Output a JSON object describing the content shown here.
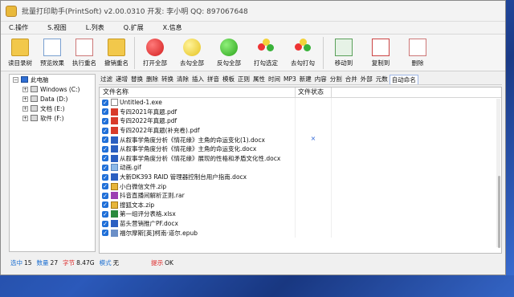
{
  "window": {
    "title": "批量打印助手(PrintSoft) v2.00.0310 开发: 李小明 QQ: 897067648"
  },
  "menu": [
    "C.操作",
    "S.视图",
    "L.列表",
    "Q.扩展",
    "X.信息"
  ],
  "toolbar": [
    {
      "label": "读目录树",
      "icon": "folder-icon"
    },
    {
      "label": "预览效果",
      "icon": "preview-icon"
    },
    {
      "label": "执行重名",
      "icon": "rename-icon"
    },
    {
      "label": "撤销重名",
      "icon": "undo-rename-icon"
    },
    {
      "label": "打开全部",
      "icon": "open-all-icon"
    },
    {
      "label": "去勾全部",
      "icon": "uncheck-all-icon"
    },
    {
      "label": "反勾全部",
      "icon": "invert-check-icon"
    },
    {
      "label": "打勾选定",
      "icon": "check-selected-icon"
    },
    {
      "label": "去勾打勾",
      "icon": "toggle-check-icon"
    },
    {
      "label": "移动到",
      "icon": "move-to-icon"
    },
    {
      "label": "复制到",
      "icon": "copy-to-icon"
    },
    {
      "label": "删除",
      "icon": "delete-icon"
    }
  ],
  "tree": [
    {
      "label": "此电脑",
      "level": 0
    },
    {
      "label": "Windows (C:)",
      "level": 1
    },
    {
      "label": "Data (D:)",
      "level": 1
    },
    {
      "label": "文档 (E:)",
      "level": 1
    },
    {
      "label": "软件 (F:)",
      "level": 1
    }
  ],
  "func_tabs": [
    "过滤",
    "递增",
    "替换",
    "删除",
    "转换",
    "清除",
    "插入",
    "拼音",
    "模板",
    "正则",
    "属性",
    "时间",
    "MP3",
    "新建",
    "内容",
    "分割",
    "合并",
    "外部",
    "元数",
    "自动命名"
  ],
  "table": {
    "col_name": "文件名称",
    "col_status": "文件状态",
    "rows": [
      {
        "name": "Untitled-1.exe",
        "type": "txt",
        "status": ""
      },
      {
        "name": "专四2021年真题.pdf",
        "type": "pdf",
        "status": ""
      },
      {
        "name": "专四2022年真题.pdf",
        "type": "pdf",
        "status": ""
      },
      {
        "name": "专四2022年真题(补充卷).pdf",
        "type": "pdf",
        "status": ""
      },
      {
        "name": "从叙事学角度分析《情花缘》主角的命运变化(1).docx",
        "type": "docx",
        "status": "×"
      },
      {
        "name": "从叙事学角度分析《情花缘》主角的命运变化.docx",
        "type": "docx",
        "status": ""
      },
      {
        "name": "从叙事学角度分析《情花缘》展现的性格和矛盾文化性.docx",
        "type": "docx",
        "status": ""
      },
      {
        "name": "动画.gif",
        "type": "gif",
        "status": ""
      },
      {
        "name": "大新DK393 RAID 管理器控制台用户指南.docx",
        "type": "docx",
        "status": ""
      },
      {
        "name": "小白微信文件.zip",
        "type": "zip",
        "status": ""
      },
      {
        "name": "抖音直播间解析正则.rar",
        "type": "rar",
        "status": ""
      },
      {
        "name": "搜狐文本.zip",
        "type": "zip",
        "status": ""
      },
      {
        "name": "第一组评分表格.xlsx",
        "type": "xlsx",
        "status": ""
      },
      {
        "name": "苗头营销推广PF.docx",
        "type": "docx",
        "status": ""
      },
      {
        "name": "福尔摩斯[英]柯南·道尔.epub",
        "type": "epub",
        "status": ""
      }
    ]
  },
  "status": {
    "selected_label": "选中",
    "selected_value": "15",
    "count_label": "数量",
    "count_value": "27",
    "size_label": "字节",
    "size_value": "8.47G",
    "mode_label": "模式",
    "mode_value": "无",
    "hint_label": "提示",
    "hint_value": "OK"
  }
}
